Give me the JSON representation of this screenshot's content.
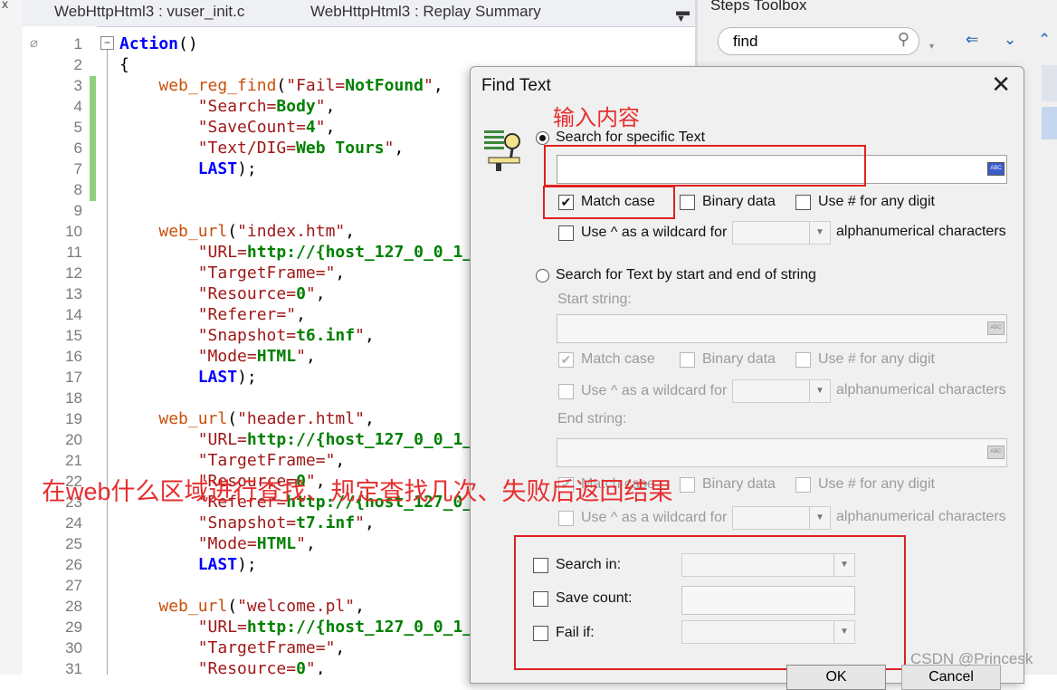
{
  "editor": {
    "tabs": [
      "WebHttpHtml3 : vuser_init.c",
      "WebHttpHtml3 : Replay Summary"
    ],
    "line_numbers": [
      "1",
      "2",
      "3",
      "4",
      "5",
      "6",
      "7",
      "8",
      "9",
      "10",
      "11",
      "12",
      "13",
      "14",
      "15",
      "16",
      "17",
      "18",
      "19",
      "20",
      "21",
      "22",
      "23",
      "24",
      "25",
      "26",
      "27",
      "28",
      "29",
      "30",
      "31"
    ],
    "fold_symbol": "−",
    "code_lines": [
      [
        {
          "t": "kw",
          "v": "Action"
        },
        {
          "t": "pl",
          "v": "()"
        }
      ],
      [
        {
          "t": "pl",
          "v": "{"
        }
      ],
      [
        {
          "t": "pl",
          "v": "    "
        },
        {
          "t": "fn",
          "v": "web_reg_find"
        },
        {
          "t": "pl",
          "v": "("
        },
        {
          "t": "str",
          "v": "\"Fail="
        },
        {
          "t": "sv",
          "v": "NotFound"
        },
        {
          "t": "str",
          "v": "\""
        },
        {
          "t": "pl",
          "v": ","
        }
      ],
      [
        {
          "t": "pl",
          "v": "        "
        },
        {
          "t": "str",
          "v": "\"Search="
        },
        {
          "t": "sv",
          "v": "Body"
        },
        {
          "t": "str",
          "v": "\""
        },
        {
          "t": "pl",
          "v": ","
        }
      ],
      [
        {
          "t": "pl",
          "v": "        "
        },
        {
          "t": "str",
          "v": "\"SaveCount="
        },
        {
          "t": "sv",
          "v": "4"
        },
        {
          "t": "str",
          "v": "\""
        },
        {
          "t": "pl",
          "v": ","
        }
      ],
      [
        {
          "t": "pl",
          "v": "        "
        },
        {
          "t": "str",
          "v": "\"Text/DIG="
        },
        {
          "t": "sv",
          "v": "Web Tours"
        },
        {
          "t": "str",
          "v": "\""
        },
        {
          "t": "pl",
          "v": ","
        }
      ],
      [
        {
          "t": "pl",
          "v": "        "
        },
        {
          "t": "kw",
          "v": "LAST"
        },
        {
          "t": "pl",
          "v": ");"
        }
      ],
      [],
      [],
      [
        {
          "t": "pl",
          "v": "    "
        },
        {
          "t": "fn",
          "v": "web_url"
        },
        {
          "t": "pl",
          "v": "("
        },
        {
          "t": "str",
          "v": "\"index.htm\""
        },
        {
          "t": "pl",
          "v": ","
        }
      ],
      [
        {
          "t": "pl",
          "v": "        "
        },
        {
          "t": "str",
          "v": "\"URL="
        },
        {
          "t": "sv",
          "v": "http://{host_127_0_0_1_"
        }
      ],
      [
        {
          "t": "pl",
          "v": "        "
        },
        {
          "t": "str",
          "v": "\"TargetFrame=\""
        },
        {
          "t": "pl",
          "v": ","
        }
      ],
      [
        {
          "t": "pl",
          "v": "        "
        },
        {
          "t": "str",
          "v": "\"Resource="
        },
        {
          "t": "sv",
          "v": "0"
        },
        {
          "t": "str",
          "v": "\""
        },
        {
          "t": "pl",
          "v": ","
        }
      ],
      [
        {
          "t": "pl",
          "v": "        "
        },
        {
          "t": "str",
          "v": "\"Referer=\""
        },
        {
          "t": "pl",
          "v": ","
        }
      ],
      [
        {
          "t": "pl",
          "v": "        "
        },
        {
          "t": "str",
          "v": "\"Snapshot="
        },
        {
          "t": "sv",
          "v": "t6.inf"
        },
        {
          "t": "str",
          "v": "\""
        },
        {
          "t": "pl",
          "v": ","
        }
      ],
      [
        {
          "t": "pl",
          "v": "        "
        },
        {
          "t": "str",
          "v": "\"Mode="
        },
        {
          "t": "sv",
          "v": "HTML"
        },
        {
          "t": "str",
          "v": "\""
        },
        {
          "t": "pl",
          "v": ","
        }
      ],
      [
        {
          "t": "pl",
          "v": "        "
        },
        {
          "t": "kw",
          "v": "LAST"
        },
        {
          "t": "pl",
          "v": ");"
        }
      ],
      [],
      [
        {
          "t": "pl",
          "v": "    "
        },
        {
          "t": "fn",
          "v": "web_url"
        },
        {
          "t": "pl",
          "v": "("
        },
        {
          "t": "str",
          "v": "\"header.html\""
        },
        {
          "t": "pl",
          "v": ","
        }
      ],
      [
        {
          "t": "pl",
          "v": "        "
        },
        {
          "t": "str",
          "v": "\"URL="
        },
        {
          "t": "sv",
          "v": "http://{host_127_0_0_1_"
        }
      ],
      [
        {
          "t": "pl",
          "v": "        "
        },
        {
          "t": "str",
          "v": "\"TargetFrame=\""
        },
        {
          "t": "pl",
          "v": ","
        }
      ],
      [
        {
          "t": "pl",
          "v": "        "
        },
        {
          "t": "str",
          "v": "\"Resource="
        },
        {
          "t": "sv",
          "v": "0"
        },
        {
          "t": "str",
          "v": "\""
        },
        {
          "t": "pl",
          "v": ","
        }
      ],
      [
        {
          "t": "pl",
          "v": "        "
        },
        {
          "t": "str",
          "v": "\"Referer="
        },
        {
          "t": "sv",
          "v": "http://{host_127_0_"
        }
      ],
      [
        {
          "t": "pl",
          "v": "        "
        },
        {
          "t": "str",
          "v": "\"Snapshot="
        },
        {
          "t": "sv",
          "v": "t7.inf"
        },
        {
          "t": "str",
          "v": "\""
        },
        {
          "t": "pl",
          "v": ","
        }
      ],
      [
        {
          "t": "pl",
          "v": "        "
        },
        {
          "t": "str",
          "v": "\"Mode="
        },
        {
          "t": "sv",
          "v": "HTML"
        },
        {
          "t": "str",
          "v": "\""
        },
        {
          "t": "pl",
          "v": ","
        }
      ],
      [
        {
          "t": "pl",
          "v": "        "
        },
        {
          "t": "kw",
          "v": "LAST"
        },
        {
          "t": "pl",
          "v": ");"
        }
      ],
      [],
      [
        {
          "t": "pl",
          "v": "    "
        },
        {
          "t": "fn",
          "v": "web_url"
        },
        {
          "t": "pl",
          "v": "("
        },
        {
          "t": "str",
          "v": "\"welcome.pl\""
        },
        {
          "t": "pl",
          "v": ","
        }
      ],
      [
        {
          "t": "pl",
          "v": "        "
        },
        {
          "t": "str",
          "v": "\"URL="
        },
        {
          "t": "sv",
          "v": "http://{host_127_0_0_1_"
        }
      ],
      [
        {
          "t": "pl",
          "v": "        "
        },
        {
          "t": "str",
          "v": "\"TargetFrame=\""
        },
        {
          "t": "pl",
          "v": ","
        }
      ],
      [
        {
          "t": "pl",
          "v": "        "
        },
        {
          "t": "str",
          "v": "\"Resource="
        },
        {
          "t": "sv",
          "v": "0"
        },
        {
          "t": "str",
          "v": "\""
        },
        {
          "t": "pl",
          "v": ","
        }
      ]
    ]
  },
  "toolbox": {
    "title": "Steps Toolbox",
    "search_value": "find",
    "search_icon": "magnifier-icon",
    "buttons": [
      "back-arrow-icon",
      "expand-down-icon",
      "collapse-up-icon"
    ]
  },
  "dialog": {
    "title": "Find Text",
    "close_glyph": "✕",
    "option_specific": "Search for specific Text",
    "option_start_end": "Search for Text by start and end of string",
    "match_case": "Match case",
    "binary_data": "Binary data",
    "use_hash": "Use # for any digit",
    "use_caret": "Use ^ as a wildcard for",
    "alnum": "alphanumerical characters",
    "start_string": "Start string:",
    "end_string": "End string:",
    "search_in": "Search in:",
    "save_count": "Save count:",
    "fail_if": "Fail if:",
    "ok": "OK",
    "cancel": "Cancel",
    "abc_glyph": "ABC",
    "check_glyph": "✔",
    "dropdown_glyph": "▼"
  },
  "annotations": {
    "top": "输入内容",
    "middle": "在web什么区域进行查找、规定查找几次、失败后返回结果",
    "color": "#e62e2e"
  },
  "watermark": "CSDN @Princesk",
  "left_strip_glyph": "x"
}
